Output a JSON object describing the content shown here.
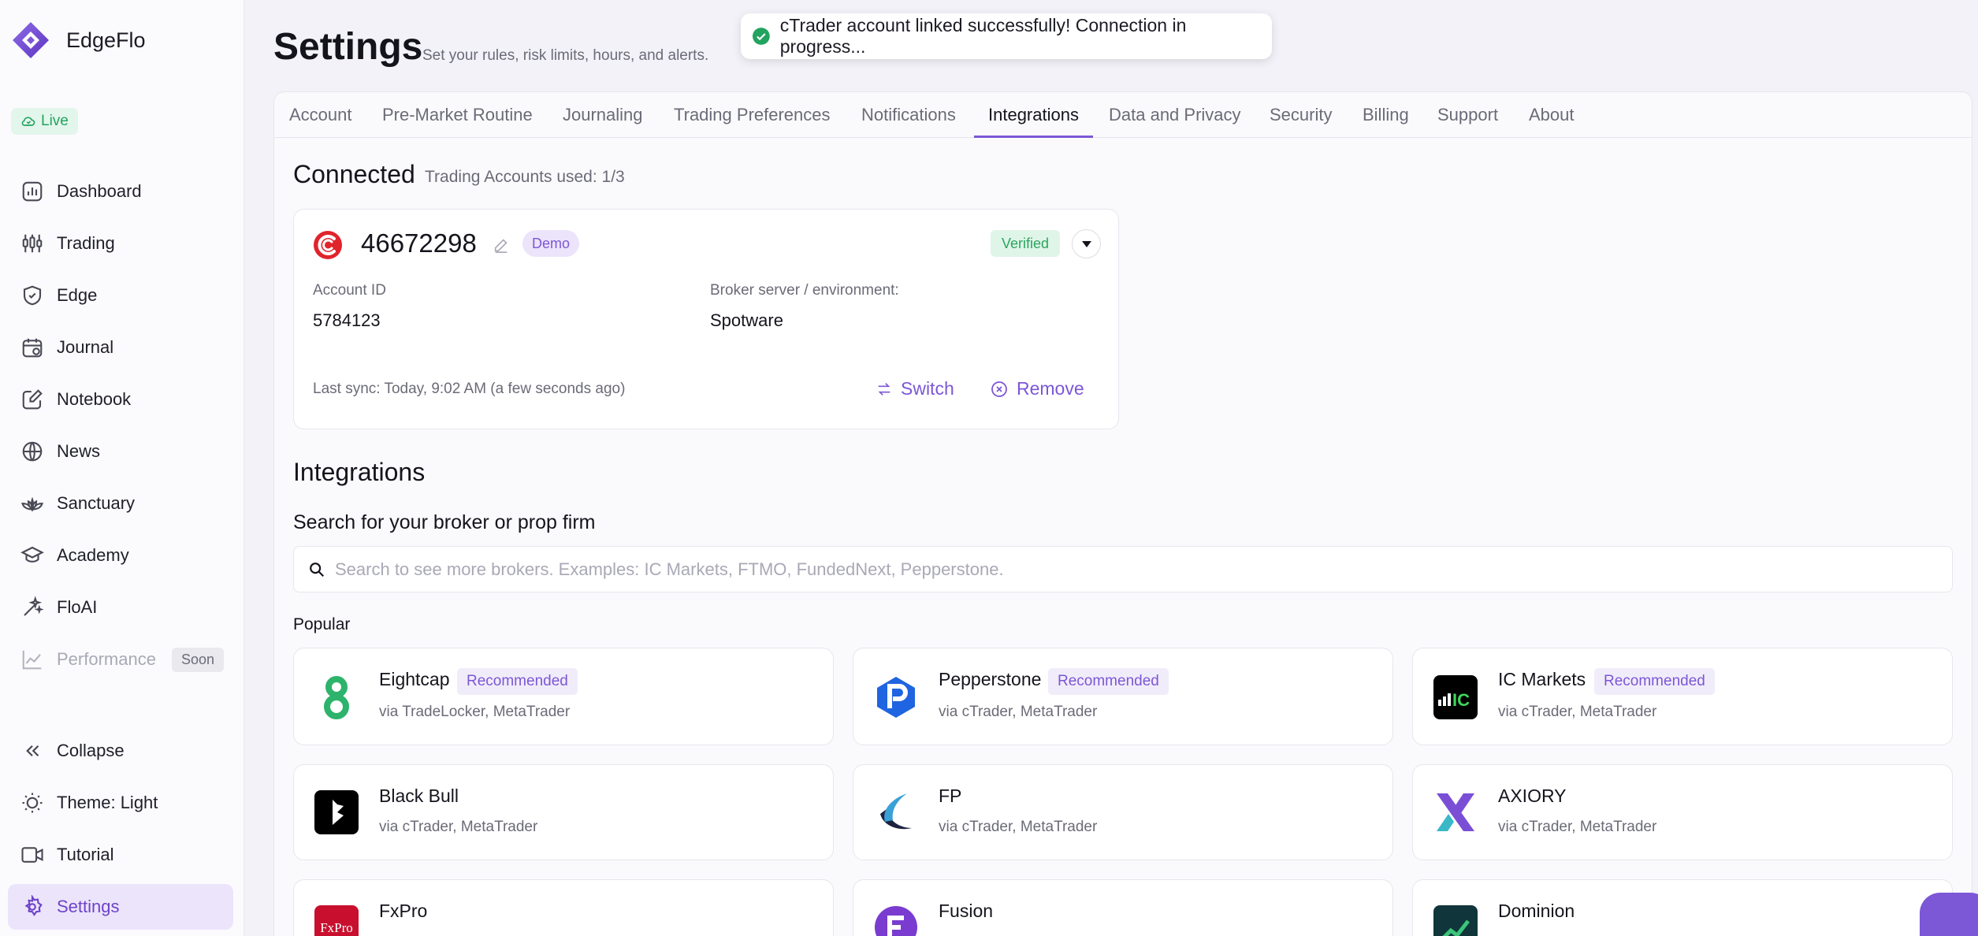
{
  "app": {
    "name": "EdgeFlo",
    "status": "Live"
  },
  "sidebar": {
    "items": [
      {
        "label": "Dashboard"
      },
      {
        "label": "Trading"
      },
      {
        "label": "Edge"
      },
      {
        "label": "Journal"
      },
      {
        "label": "Notebook"
      },
      {
        "label": "News"
      },
      {
        "label": "Sanctuary"
      },
      {
        "label": "Academy"
      },
      {
        "label": "FloAI"
      },
      {
        "label": "Performance",
        "badge": "Soon"
      }
    ],
    "bottom": [
      {
        "label": "Collapse"
      },
      {
        "label": "Theme: Light"
      },
      {
        "label": "Tutorial"
      },
      {
        "label": "Settings"
      }
    ]
  },
  "header": {
    "title": "Settings",
    "subtitle": "Set your rules, risk limits, hours, and alerts."
  },
  "toast": {
    "message": "cTrader account linked successfully! Connection in progress..."
  },
  "tabs": [
    "Account",
    "Pre-Market Routine",
    "Journaling",
    "Trading Preferences",
    "Notifications",
    "Integrations",
    "Data and Privacy",
    "Security",
    "Billing",
    "Support",
    "About"
  ],
  "connected": {
    "title": "Connected",
    "usage": "Trading Accounts used: 1/3",
    "account": {
      "number": "46672298",
      "type_badge": "Demo",
      "status_badge": "Verified",
      "account_id_label": "Account ID",
      "account_id": "5784123",
      "server_label": "Broker server / environment:",
      "server": "Spotware",
      "last_sync": "Last sync: Today, 9:02 AM (a few seconds ago)",
      "switch_label": "Switch",
      "remove_label": "Remove"
    }
  },
  "integrations": {
    "title": "Integrations",
    "search_title": "Search for your broker or prop firm",
    "search_placeholder": "Search to see more brokers. Examples: IC Markets, FTMO, FundedNext, Pepperstone.",
    "popular_label": "Popular",
    "brokers": [
      {
        "name": "Eightcap",
        "badge": "Recommended",
        "via": "via TradeLocker, MetaTrader"
      },
      {
        "name": "Pepperstone",
        "badge": "Recommended",
        "via": "via cTrader, MetaTrader"
      },
      {
        "name": "IC Markets",
        "badge": "Recommended",
        "via": "via cTrader, MetaTrader"
      },
      {
        "name": "Black Bull",
        "via": "via cTrader, MetaTrader"
      },
      {
        "name": "FP",
        "via": "via cTrader, MetaTrader"
      },
      {
        "name": "AXIORY",
        "via": "via cTrader, MetaTrader"
      },
      {
        "name": "FxPro"
      },
      {
        "name": "Fusion"
      },
      {
        "name": "Dominion"
      }
    ]
  },
  "colors": {
    "accent": "#7c57d6",
    "success": "#22a35f",
    "background": "#f2f2f8"
  }
}
